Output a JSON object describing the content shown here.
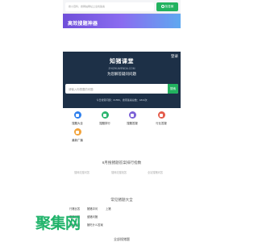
{
  "top_search": {
    "placeholder": "搜小百科、搜网站网址上全找答案",
    "button_label": "找答案"
  },
  "banner": {
    "title": "高效搜题神器"
  },
  "hero": {
    "login_label": "登录",
    "site_title": "知猪课堂",
    "domain": "ZHIZHUWENDA.COM",
    "slogan": "为您解答疑问问题",
    "search_placeholder": "请输入你想要的问题",
    "search_button": "搜索",
    "stats": "今日搜索问题：61559，搜索答案总数：1844次"
  },
  "icons": [
    {
      "label": "搜题大全",
      "color": "#2f80ed"
    },
    {
      "label": "搜题排行",
      "color": "#2ab56e"
    },
    {
      "label": "搜题答疑",
      "color": "#7b61d6"
    },
    {
      "label": "行业答疑",
      "color": "#e45b4a"
    },
    {
      "label": "最新广播",
      "color": "#f2a33a"
    }
  ],
  "hot_section": {
    "title": "6月搜猪题答案排行指数",
    "links": [
      "搜网站搜问答",
      "搜网站搜找答",
      "全站搜猪问答"
    ]
  },
  "category_section": {
    "title": "常见猪题大全",
    "rows": [
      [
        "行猪比答",
        "猪猪冲问",
        "上猪"
      ],
      [
        "康猪问猪",
        "健猪问猪"
      ],
      [
        "猪头答题",
        "猪吃什么答案"
      ]
    ]
  },
  "watermark": {
    "text": "聚集网",
    "subtitle": "搜猪答题大全"
  },
  "bottom_title": "全部搜猪题"
}
